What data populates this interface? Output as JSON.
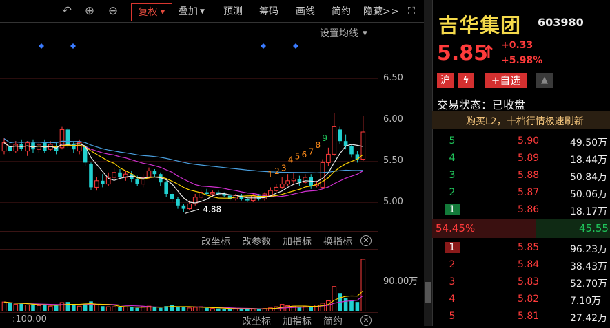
{
  "toolbar": {
    "undo_icon": "undo-icon",
    "zoom_in_icon": "zoom-in-icon",
    "zoom_out_icon": "zoom-out-icon",
    "fuquan": "复权",
    "overlay": "叠加",
    "forecast": "预测",
    "chips": "筹码",
    "draw": "画线",
    "simple": "简约",
    "hide": "隐藏>>",
    "fullscreen_icon": "fullscreen-icon"
  },
  "chart": {
    "settings_label": "设置均线",
    "y_labels": [
      "6.50",
      "6.00",
      "5.50",
      "5.00"
    ],
    "low_label": "4.88",
    "volume_max_label": "90.00万",
    "bottom_left_label": ":100.00",
    "mid_toolbar": [
      "改坐标",
      "改参数",
      "加指标",
      "换指标"
    ],
    "bottom_toolbar": [
      "改坐标",
      "加指标",
      "简约"
    ],
    "seq_numbers": [
      "1",
      "2",
      "3",
      "4",
      "5",
      "6",
      "7",
      "8",
      "9"
    ],
    "colors": {
      "up": "#ff3b3b",
      "down": "#21d0d0",
      "ma5": "#e8e8e8",
      "ma10": "#ffd400",
      "ma20": "#d030d0",
      "ma60": "#4aa0e0",
      "diamond": "#3a7bff"
    }
  },
  "chart_data": {
    "type": "candlestick",
    "ylim": [
      4.7,
      6.65
    ],
    "yticks": [
      6.5,
      6.0,
      5.5,
      5.0
    ],
    "candles": [
      {
        "o": 5.62,
        "c": 5.72,
        "h": 5.78,
        "l": 5.58
      },
      {
        "o": 5.68,
        "c": 5.62,
        "h": 5.72,
        "l": 5.6
      },
      {
        "o": 5.62,
        "c": 5.7,
        "h": 5.74,
        "l": 5.6
      },
      {
        "o": 5.7,
        "c": 5.65,
        "h": 5.76,
        "l": 5.62
      },
      {
        "o": 5.62,
        "c": 5.72,
        "h": 5.74,
        "l": 5.56
      },
      {
        "o": 5.72,
        "c": 5.64,
        "h": 5.76,
        "l": 5.6
      },
      {
        "o": 5.64,
        "c": 5.7,
        "h": 5.73,
        "l": 5.6
      },
      {
        "o": 5.72,
        "c": 5.62,
        "h": 5.76,
        "l": 5.6
      },
      {
        "o": 5.64,
        "c": 5.7,
        "h": 5.74,
        "l": 5.62
      },
      {
        "o": 5.68,
        "c": 5.62,
        "h": 5.72,
        "l": 5.58
      },
      {
        "o": 5.66,
        "c": 5.88,
        "h": 5.92,
        "l": 5.64
      },
      {
        "o": 5.88,
        "c": 5.68,
        "h": 5.9,
        "l": 5.66
      },
      {
        "o": 5.7,
        "c": 5.64,
        "h": 5.74,
        "l": 5.6
      },
      {
        "o": 5.62,
        "c": 5.72,
        "h": 5.76,
        "l": 5.58
      },
      {
        "o": 5.68,
        "c": 5.48,
        "h": 5.72,
        "l": 5.44
      },
      {
        "o": 5.46,
        "c": 5.18,
        "h": 5.48,
        "l": 5.15
      },
      {
        "o": 5.18,
        "c": 5.26,
        "h": 5.3,
        "l": 5.14
      },
      {
        "o": 5.26,
        "c": 5.22,
        "h": 5.34,
        "l": 5.18
      },
      {
        "o": 5.22,
        "c": 5.3,
        "h": 5.36,
        "l": 5.2
      },
      {
        "o": 5.3,
        "c": 5.36,
        "h": 5.42,
        "l": 5.26
      },
      {
        "o": 5.36,
        "c": 5.3,
        "h": 5.4,
        "l": 5.28
      },
      {
        "o": 5.3,
        "c": 5.34,
        "h": 5.38,
        "l": 5.26
      },
      {
        "o": 5.34,
        "c": 5.28,
        "h": 5.38,
        "l": 5.24
      },
      {
        "o": 5.28,
        "c": 5.22,
        "h": 5.32,
        "l": 5.2
      },
      {
        "o": 5.22,
        "c": 5.3,
        "h": 5.34,
        "l": 5.18
      },
      {
        "o": 5.3,
        "c": 5.38,
        "h": 5.42,
        "l": 5.28
      },
      {
        "o": 5.38,
        "c": 5.34,
        "h": 5.4,
        "l": 5.3
      },
      {
        "o": 5.34,
        "c": 5.24,
        "h": 5.36,
        "l": 5.2
      },
      {
        "o": 5.24,
        "c": 5.1,
        "h": 5.26,
        "l": 5.06
      },
      {
        "o": 5.1,
        "c": 5.04,
        "h": 5.12,
        "l": 5.0
      },
      {
        "o": 5.04,
        "c": 4.96,
        "h": 5.06,
        "l": 4.92
      },
      {
        "o": 4.96,
        "c": 4.92,
        "h": 4.98,
        "l": 4.88
      },
      {
        "o": 4.92,
        "c": 4.98,
        "h": 5.02,
        "l": 4.9
      },
      {
        "o": 4.98,
        "c": 5.06,
        "h": 5.1,
        "l": 4.96
      },
      {
        "o": 5.06,
        "c": 5.12,
        "h": 5.14,
        "l": 5.04
      },
      {
        "o": 5.12,
        "c": 5.1,
        "h": 5.16,
        "l": 5.08
      },
      {
        "o": 5.1,
        "c": 5.12,
        "h": 5.14,
        "l": 5.06
      },
      {
        "o": 5.12,
        "c": 5.1,
        "h": 5.14,
        "l": 5.08
      },
      {
        "o": 5.1,
        "c": 5.08,
        "h": 5.12,
        "l": 5.06
      },
      {
        "o": 5.08,
        "c": 5.04,
        "h": 5.1,
        "l": 5.02
      },
      {
        "o": 5.04,
        "c": 5.08,
        "h": 5.1,
        "l": 5.02
      },
      {
        "o": 5.08,
        "c": 5.04,
        "h": 5.1,
        "l": 5.02
      },
      {
        "o": 5.04,
        "c": 5.02,
        "h": 5.06,
        "l": 5.0
      },
      {
        "o": 5.02,
        "c": 5.08,
        "h": 5.1,
        "l": 5.0
      },
      {
        "o": 5.08,
        "c": 5.04,
        "h": 5.1,
        "l": 5.02
      },
      {
        "o": 5.04,
        "c": 5.1,
        "h": 5.12,
        "l": 5.02
      },
      {
        "o": 5.08,
        "c": 5.14,
        "h": 5.18,
        "l": 5.06
      },
      {
        "o": 5.14,
        "c": 5.18,
        "h": 5.22,
        "l": 5.12
      },
      {
        "o": 5.18,
        "c": 5.22,
        "h": 5.3,
        "l": 5.16
      },
      {
        "o": 5.22,
        "c": 5.26,
        "h": 5.34,
        "l": 5.2
      },
      {
        "o": 5.26,
        "c": 5.28,
        "h": 5.36,
        "l": 5.22
      },
      {
        "o": 5.28,
        "c": 5.24,
        "h": 5.32,
        "l": 5.2
      },
      {
        "o": 5.24,
        "c": 5.3,
        "h": 5.34,
        "l": 5.22
      },
      {
        "o": 5.3,
        "c": 5.2,
        "h": 5.34,
        "l": 5.16
      },
      {
        "o": 5.2,
        "c": 5.22,
        "h": 5.26,
        "l": 5.18
      },
      {
        "o": 5.18,
        "c": 5.48,
        "h": 5.52,
        "l": 5.16
      },
      {
        "o": 5.48,
        "c": 5.58,
        "h": 5.66,
        "l": 5.44
      },
      {
        "o": 5.58,
        "c": 5.92,
        "h": 6.08,
        "l": 5.56
      },
      {
        "o": 5.88,
        "c": 5.74,
        "h": 5.92,
        "l": 5.7
      },
      {
        "o": 5.74,
        "c": 5.68,
        "h": 5.82,
        "l": 5.64
      },
      {
        "o": 5.68,
        "c": 5.58,
        "h": 5.7,
        "l": 5.54
      },
      {
        "o": 5.58,
        "c": 5.52,
        "h": 5.62,
        "l": 5.48
      },
      {
        "o": 5.52,
        "c": 5.85,
        "h": 6.05,
        "l": 5.5
      }
    ],
    "volume_ylim": [
      0,
      1000000
    ],
    "volumes": [
      160000,
      140000,
      120000,
      130000,
      110000,
      120000,
      100000,
      110000,
      90000,
      100000,
      150000,
      160000,
      110000,
      90000,
      130000,
      170000,
      120000,
      90000,
      80000,
      80000,
      70000,
      80000,
      70000,
      60000,
      80000,
      90000,
      70000,
      60000,
      90000,
      110000,
      80000,
      70000,
      60000,
      70000,
      80000,
      60000,
      50000,
      50000,
      40000,
      50000,
      40000,
      40000,
      50000,
      40000,
      40000,
      50000,
      60000,
      80000,
      120000,
      100000,
      90000,
      70000,
      80000,
      90000,
      110000,
      140000,
      180000,
      420000,
      310000,
      220000,
      180000,
      160000,
      880000
    ]
  },
  "stock": {
    "name": "吉华集团",
    "code": "603980",
    "price": "5.85",
    "arrow": "↑",
    "change": "+0.33",
    "change_pct": "+5.98%",
    "tag_hu": "沪",
    "tag_lightning_icon": "lightning-icon",
    "add_watch": "+自选",
    "bell_icon": "bell-icon",
    "status": "交易状态：已收盘",
    "promo": "购买L2，十档行情极速刷新",
    "sell": [
      {
        "level": "5",
        "price": "5.90",
        "vol": "49.50万"
      },
      {
        "level": "4",
        "price": "5.89",
        "vol": "18.44万"
      },
      {
        "level": "3",
        "price": "5.88",
        "vol": "50.84万"
      },
      {
        "level": "2",
        "price": "5.87",
        "vol": "50.06万"
      },
      {
        "level": "1",
        "price": "5.86",
        "vol": "18.17万"
      }
    ],
    "ratio_buy": "54.45%",
    "ratio_sell": "45.55",
    "buy": [
      {
        "level": "1",
        "price": "5.85",
        "vol": "96.23万"
      },
      {
        "level": "2",
        "price": "5.84",
        "vol": "38.43万"
      },
      {
        "level": "3",
        "price": "5.83",
        "vol": "52.70万"
      },
      {
        "level": "4",
        "price": "5.82",
        "vol": "7.10万"
      },
      {
        "level": "5",
        "price": "5.81",
        "vol": "27.42万"
      }
    ]
  }
}
